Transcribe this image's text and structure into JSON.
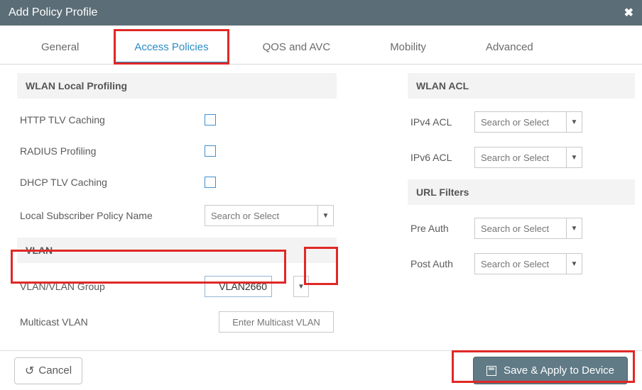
{
  "titlebar": {
    "title": "Add Policy Profile",
    "close_icon": "✖"
  },
  "tabs": {
    "general": "General",
    "access_policies": "Access Policies",
    "qos": "QOS and AVC",
    "mobility": "Mobility",
    "advanced": "Advanced"
  },
  "wlan_profiling": {
    "header": "WLAN Local Profiling",
    "http_tlv": "HTTP TLV Caching",
    "radius": "RADIUS Profiling",
    "dhcp_tlv": "DHCP TLV Caching",
    "local_sub": "Local Subscriber Policy Name",
    "local_sub_placeholder": "Search or Select"
  },
  "vlan": {
    "header": "VLAN",
    "group_label": "VLAN/VLAN Group",
    "group_value": "VLAN2660",
    "multicast_label": "Multicast VLAN",
    "multicast_placeholder": "Enter Multicast VLAN"
  },
  "wlan_acl": {
    "header": "WLAN ACL",
    "ipv4": "IPv4 ACL",
    "ipv6": "IPv6 ACL",
    "placeholder": "Search or Select"
  },
  "url_filters": {
    "header": "URL Filters",
    "pre": "Pre Auth",
    "post": "Post Auth",
    "placeholder": "Search or Select"
  },
  "footer": {
    "cancel": "Cancel",
    "save": "Save & Apply to Device"
  }
}
